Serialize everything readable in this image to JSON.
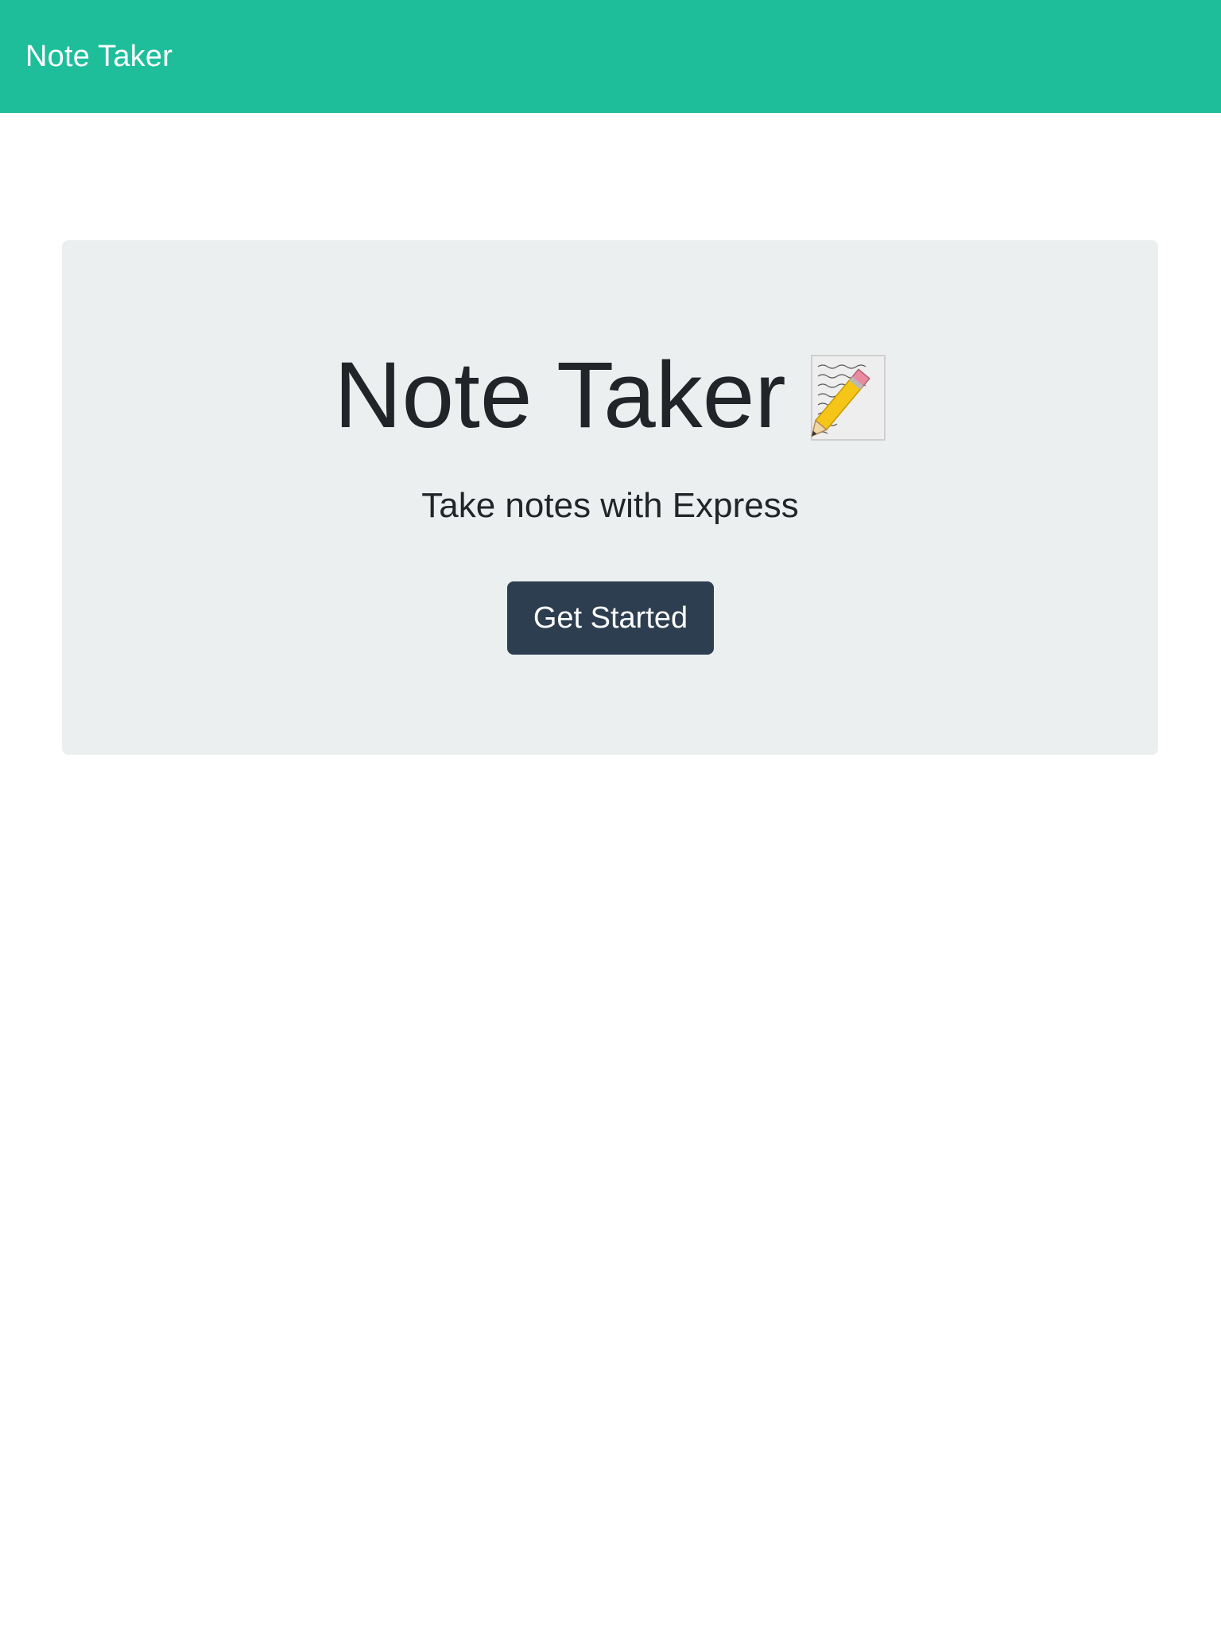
{
  "navbar": {
    "brand": "Note Taker"
  },
  "hero": {
    "title": "Note Taker",
    "title_icon": "memo-pencil-icon",
    "subtitle": "Take notes with Express",
    "cta_label": "Get Started"
  },
  "colors": {
    "navbar_bg": "#1ebe9b",
    "hero_bg": "#ebeff0",
    "button_bg": "#2d3e50",
    "text": "#212529"
  }
}
